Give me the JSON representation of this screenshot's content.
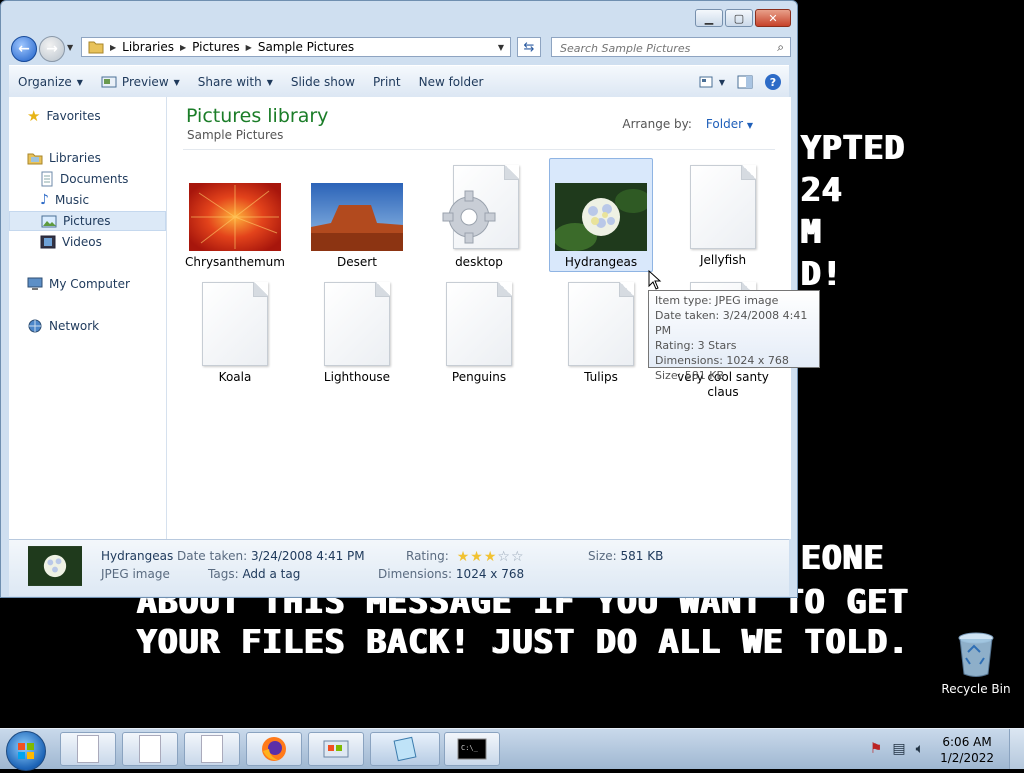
{
  "desktop": {
    "ransom_lines": [
      "YPTED",
      "24",
      "M",
      "D!",
      "EONE",
      "ABOUT THIS MESSAGE IF YOU WANT TO GET",
      "YOUR FILES BACK! JUST DO ALL WE TOLD."
    ],
    "recycle_bin_label": "Recycle Bin"
  },
  "window": {
    "breadcrumb": [
      "Libraries",
      "Pictures",
      "Sample Pictures"
    ],
    "search_placeholder": "Search Sample Pictures",
    "toolbar": {
      "organize": "Organize",
      "preview": "Preview",
      "share_with": "Share with",
      "slide_show": "Slide show",
      "print": "Print",
      "new_folder": "New folder"
    },
    "sidebar": {
      "favorites": "Favorites",
      "libraries": "Libraries",
      "documents": "Documents",
      "music": "Music",
      "pictures": "Pictures",
      "videos": "Videos",
      "my_computer": "My Computer",
      "network": "Network"
    },
    "library_title": "Pictures library",
    "library_subtitle": "Sample Pictures",
    "arrange_by_label": "Arrange by:",
    "arrange_by_value": "Folder",
    "files": [
      {
        "name": "Chrysanthemum",
        "type": "photo",
        "selected": false
      },
      {
        "name": "Desert",
        "type": "photo",
        "selected": false
      },
      {
        "name": "desktop",
        "type": "settings",
        "selected": false
      },
      {
        "name": "Hydrangeas",
        "type": "photo",
        "selected": true
      },
      {
        "name": "Jellyfish",
        "type": "blank",
        "selected": false
      },
      {
        "name": "Koala",
        "type": "blank",
        "selected": false
      },
      {
        "name": "Lighthouse",
        "type": "blank",
        "selected": false
      },
      {
        "name": "Penguins",
        "type": "blank",
        "selected": false
      },
      {
        "name": "Tulips",
        "type": "blank",
        "selected": false
      },
      {
        "name": "very cool santy claus",
        "type": "blank",
        "selected": false
      }
    ],
    "tooltip": [
      "Item type: JPEG image",
      "Date taken: 3/24/2008 4:41 PM",
      "Rating: 3 Stars",
      "Dimensions: 1024 x 768",
      "Size: 581 KB"
    ],
    "details": {
      "name": "Hydrangeas",
      "type": "JPEG image",
      "date_taken_label": "Date taken:",
      "date_taken": "3/24/2008 4:41 PM",
      "tags_label": "Tags:",
      "tags": "Add a tag",
      "rating_label": "Rating:",
      "rating_stars": 3,
      "rating_max": 5,
      "dimensions_label": "Dimensions:",
      "dimensions": "1024 x 768",
      "size_label": "Size:",
      "size": "581 KB"
    }
  },
  "taskbar": {
    "time": "6:06 AM",
    "date": "1/2/2022"
  },
  "colors": {
    "library_title": "#1b7d28",
    "link_blue": "#1f5fb9",
    "star_gold": "#f1c232",
    "desktop_bg": "#000000"
  }
}
